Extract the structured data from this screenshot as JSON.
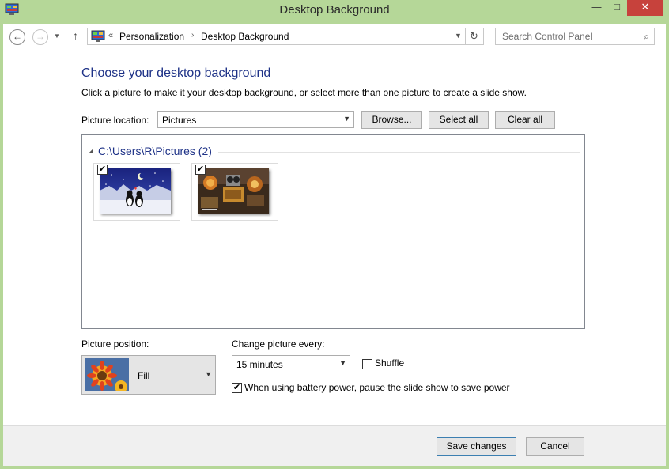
{
  "window": {
    "title": "Desktop Background",
    "minimize_glyph": "—",
    "maximize_glyph": "□",
    "close_glyph": "✕"
  },
  "navbar": {
    "back_glyph": "←",
    "forward_glyph": "→",
    "recent_glyph": "▼",
    "up_glyph": "↑",
    "crumb_prefix": "«",
    "crumbs": [
      "Personalization",
      "Desktop Background"
    ],
    "crumb_separator": "›",
    "dropdown_glyph": "▼",
    "refresh_glyph": "↻",
    "search_placeholder": "Search Control Panel",
    "search_glyph": "⌕"
  },
  "main": {
    "heading": "Choose your desktop background",
    "subtext": "Click a picture to make it your desktop background, or select more than one picture to create a slide show.",
    "location_label": "Picture location:",
    "location_value": "Pictures",
    "browse_label": "Browse...",
    "select_all_label": "Select all",
    "clear_all_label": "Clear all"
  },
  "gallery": {
    "group_arrow": "◢",
    "group_title": "C:\\Users\\R\\Pictures (2)",
    "thumbnails": [
      {
        "checked": true,
        "check_glyph": "✔"
      },
      {
        "checked": true,
        "check_glyph": "✔"
      }
    ]
  },
  "options": {
    "position_label": "Picture position:",
    "position_value": "Fill",
    "change_label": "Change picture every:",
    "change_value": "15 minutes",
    "shuffle_label": "Shuffle",
    "shuffle_checked": false,
    "battery_label": "When using battery power, pause the slide show to save power",
    "battery_checked": true,
    "battery_check_glyph": "✔",
    "arrow_glyph": "▼"
  },
  "footer": {
    "save_label": "Save changes",
    "cancel_label": "Cancel"
  },
  "colors": {
    "frame": "#b5d798",
    "heading": "#1e3287",
    "close": "#c7423c",
    "primary_border": "#3c7fb1"
  },
  "icons": [
    "control-panel-icon",
    "back-arrow-icon",
    "forward-arrow-icon",
    "up-arrow-icon",
    "refresh-icon",
    "search-icon",
    "checkmark-icon",
    "chevron-down-icon"
  ]
}
